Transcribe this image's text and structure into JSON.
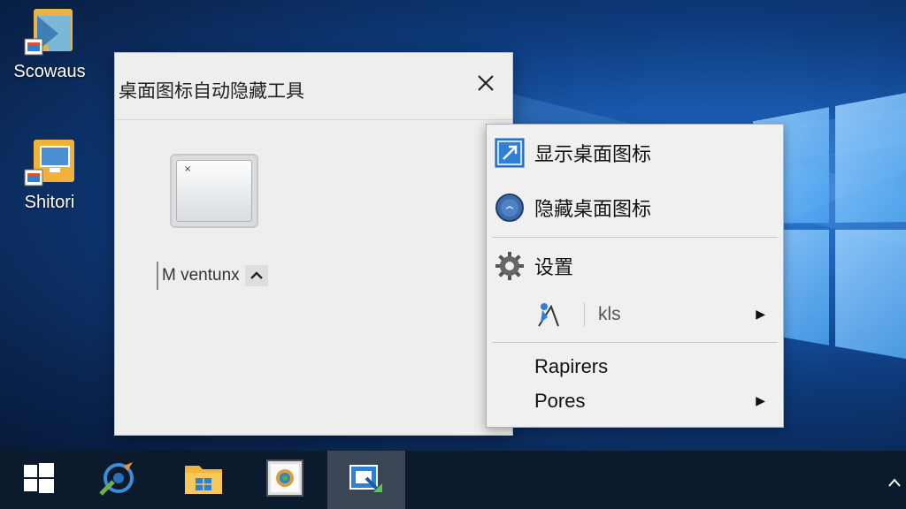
{
  "desktop": {
    "icons": [
      {
        "label": "Scowaus",
        "icon": "app-shortcut-icon"
      },
      {
        "label": "Shitori",
        "icon": "monitor-folder-icon"
      }
    ]
  },
  "dialog": {
    "title": "桌面图标自动隐藏工具",
    "close_icon": "close-icon",
    "preview_icon": "window-preview-icon",
    "dropdown_value": "M ventunx"
  },
  "context_menu": {
    "items": [
      {
        "label": "显示桌面图标",
        "icon": "show-desktop-icon"
      },
      {
        "label": "隐藏桌面图标",
        "icon": "hide-desktop-icon"
      },
      {
        "label": "设置",
        "icon": "gear-icon"
      },
      {
        "label": "kls",
        "icon": "tools-icon",
        "submenu": true
      },
      {
        "label": "Rapirers",
        "icon": ""
      },
      {
        "label": "Pores",
        "icon": "",
        "submenu": true
      }
    ]
  },
  "taskbar": {
    "buttons": [
      {
        "icon": "windows-start-icon"
      },
      {
        "icon": "browser-icon"
      },
      {
        "icon": "file-explorer-icon"
      },
      {
        "icon": "photo-viewer-icon"
      },
      {
        "icon": "desktop-hide-tool-icon",
        "active": true
      }
    ]
  },
  "colors": {
    "accent": "#2e7fd6",
    "taskbar": "#0c1a2e",
    "dialog_bg": "#eeeeec",
    "menu_bg": "#f0f0f0"
  }
}
